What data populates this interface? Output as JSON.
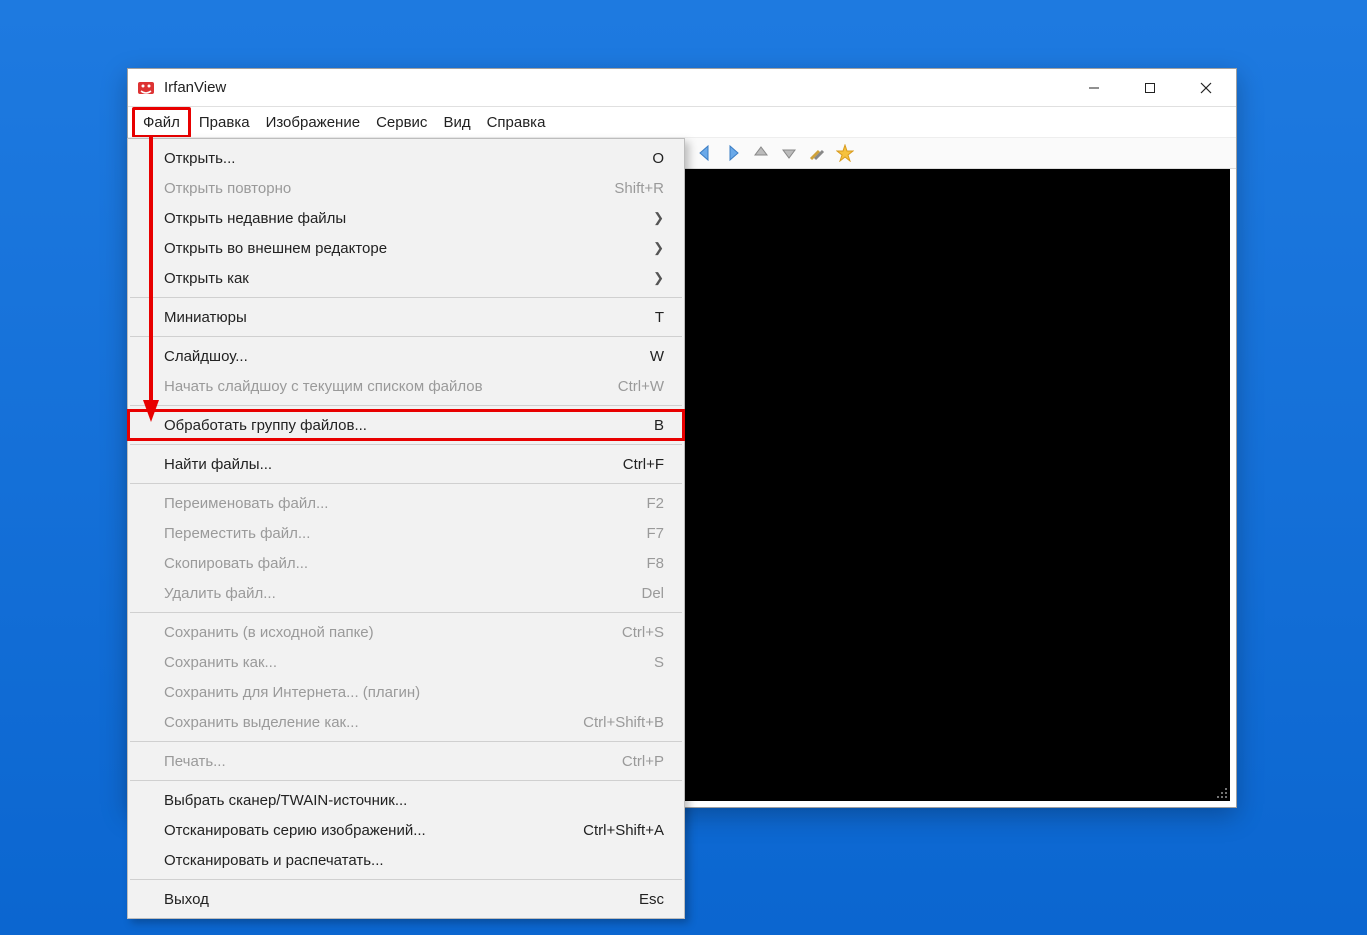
{
  "titlebar": {
    "title": "IrfanView"
  },
  "menubar": {
    "items": [
      "Файл",
      "Правка",
      "Изображение",
      "Сервис",
      "Вид",
      "Справка"
    ],
    "active_index": 0
  },
  "toolbar": {
    "icons": [
      "open",
      "prev",
      "next",
      "up",
      "down",
      "tools",
      "star"
    ]
  },
  "dropdown": {
    "items": [
      {
        "label": "Открыть...",
        "shortcut": "O",
        "disabled": false
      },
      {
        "label": "Открыть повторно",
        "shortcut": "Shift+R",
        "disabled": true
      },
      {
        "label": "Открыть недавние файлы",
        "submenu": true,
        "disabled": false
      },
      {
        "label": "Открыть во внешнем редакторе",
        "submenu": true,
        "disabled": false
      },
      {
        "label": "Открыть как",
        "submenu": true,
        "disabled": false
      },
      {
        "sep": true
      },
      {
        "label": "Миниатюры",
        "shortcut": "T",
        "disabled": false
      },
      {
        "sep": true
      },
      {
        "label": "Слайдшоу...",
        "shortcut": "W",
        "disabled": false
      },
      {
        "label": "Начать слайдшоу с текущим списком файлов",
        "shortcut": "Ctrl+W",
        "disabled": true
      },
      {
        "sep": true
      },
      {
        "label": "Обработать группу файлов...",
        "shortcut": "B",
        "disabled": false,
        "highlighted": true
      },
      {
        "sep": true
      },
      {
        "label": "Найти файлы...",
        "shortcut": "Ctrl+F",
        "disabled": false
      },
      {
        "sep": true
      },
      {
        "label": "Переименовать файл...",
        "shortcut": "F2",
        "disabled": true
      },
      {
        "label": "Переместить файл...",
        "shortcut": "F7",
        "disabled": true
      },
      {
        "label": "Скопировать файл...",
        "shortcut": "F8",
        "disabled": true
      },
      {
        "label": "Удалить файл...",
        "shortcut": "Del",
        "disabled": true
      },
      {
        "sep": true
      },
      {
        "label": "Сохранить (в исходной папке)",
        "shortcut": "Ctrl+S",
        "disabled": true
      },
      {
        "label": "Сохранить как...",
        "shortcut": "S",
        "disabled": true
      },
      {
        "label": "Сохранить для Интернета... (плагин)",
        "shortcut": "",
        "disabled": true
      },
      {
        "label": "Сохранить выделение как...",
        "shortcut": "Ctrl+Shift+B",
        "disabled": true
      },
      {
        "sep": true
      },
      {
        "label": "Печать...",
        "shortcut": "Ctrl+P",
        "disabled": true
      },
      {
        "sep": true
      },
      {
        "label": "Выбрать сканер/TWAIN-источник...",
        "shortcut": "",
        "disabled": false
      },
      {
        "label": "Отсканировать серию изображений...",
        "shortcut": "Ctrl+Shift+A",
        "disabled": false
      },
      {
        "label": "Отсканировать и распечатать...",
        "shortcut": "",
        "disabled": false
      },
      {
        "sep": true
      },
      {
        "label": "Выход",
        "shortcut": "Esc",
        "disabled": false
      }
    ]
  },
  "annotation": {
    "from_menu_index": 0,
    "to_dropdown_label": "Обработать группу файлов...",
    "color": "#e80000"
  }
}
